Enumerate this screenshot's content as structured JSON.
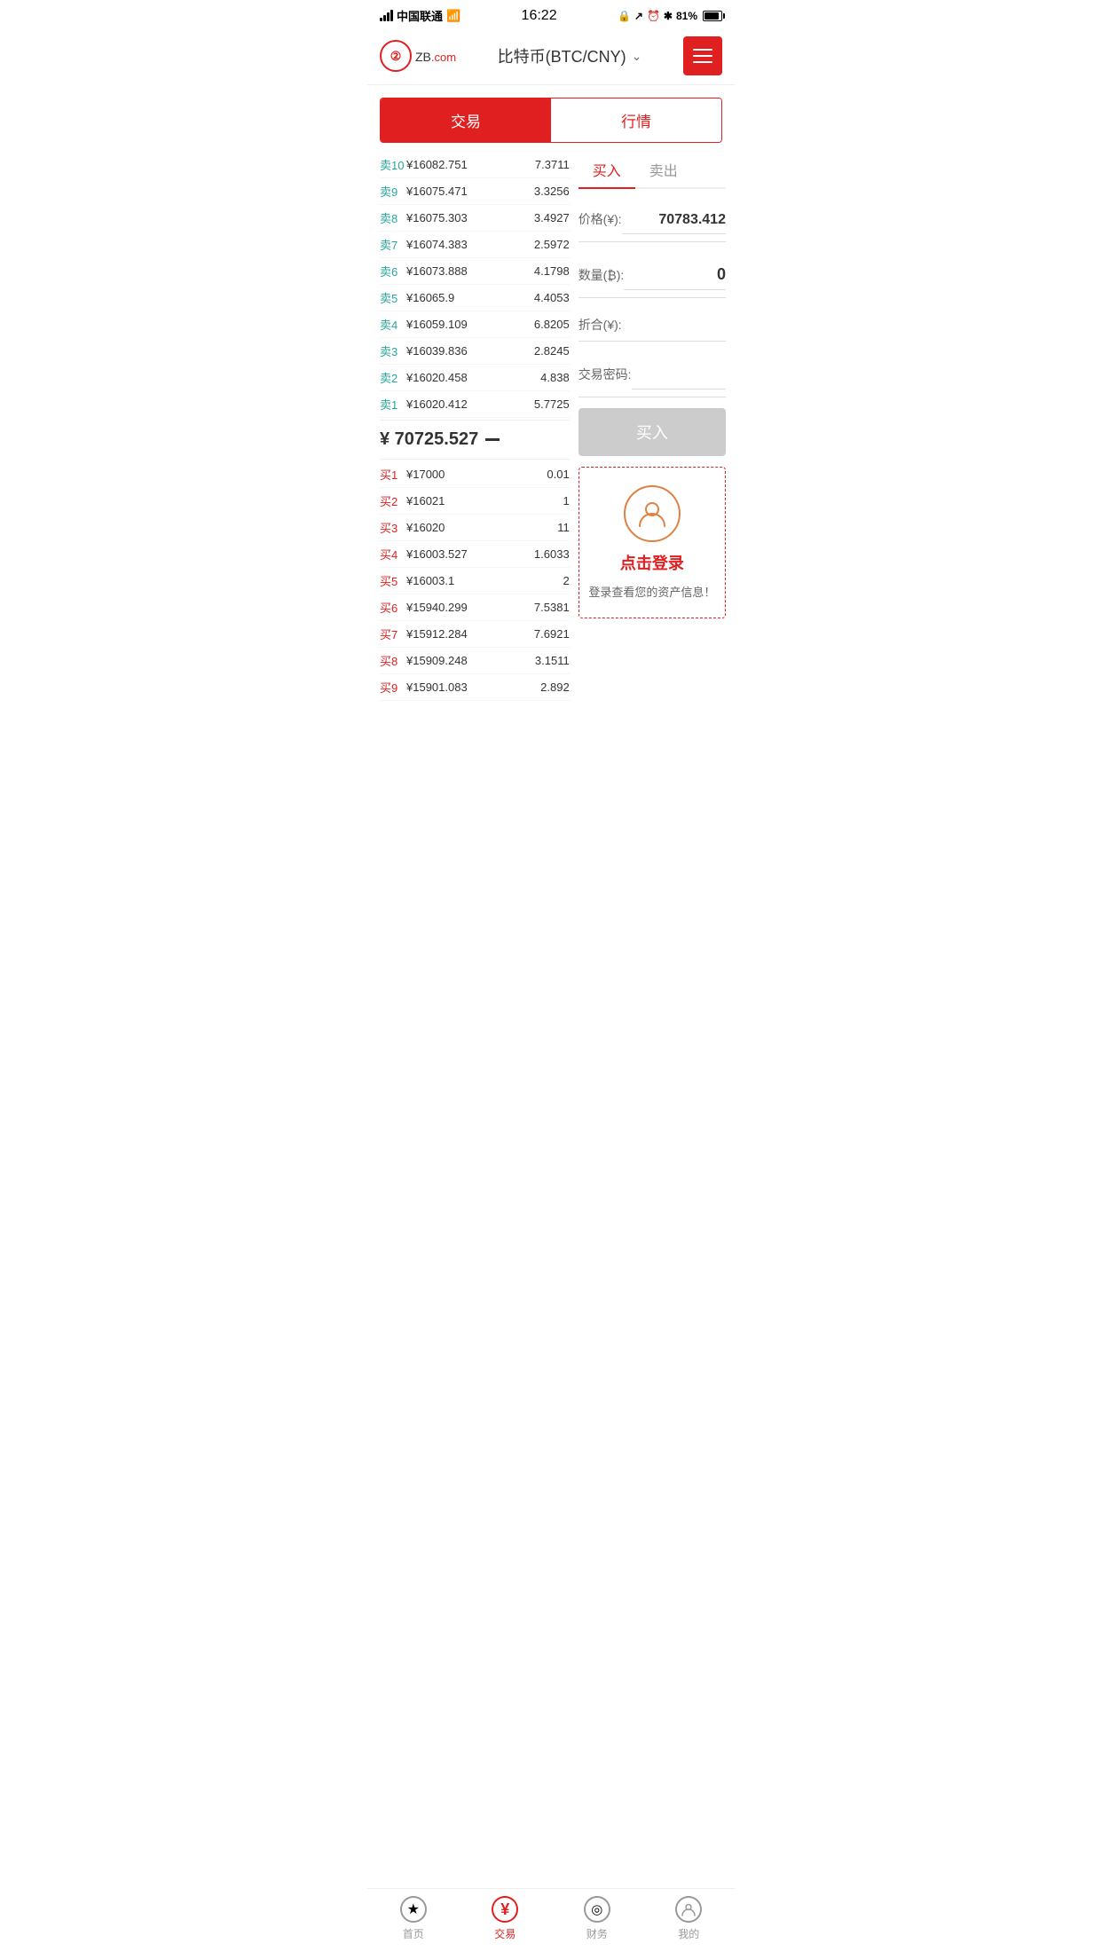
{
  "statusBar": {
    "carrier": "中国联通",
    "time": "16:22",
    "battery": "81%"
  },
  "header": {
    "logoText": "ZB",
    "logoDomain": ".com",
    "title": "比特币(BTC/CNY)",
    "menuLabel": "≡"
  },
  "tabs": {
    "left": "交易",
    "right": "行情"
  },
  "buySellTabs": {
    "buy": "买入",
    "sell": "卖出"
  },
  "sellOrders": [
    {
      "label": "卖10",
      "price": "¥16082.751",
      "qty": "7.3711"
    },
    {
      "label": "卖9",
      "price": "¥16075.471",
      "qty": "3.3256"
    },
    {
      "label": "卖8",
      "price": "¥16075.303",
      "qty": "3.4927"
    },
    {
      "label": "卖7",
      "price": "¥16074.383",
      "qty": "2.5972"
    },
    {
      "label": "卖6",
      "price": "¥16073.888",
      "qty": "4.1798"
    },
    {
      "label": "卖5",
      "price": "¥16065.9",
      "qty": "4.4053"
    },
    {
      "label": "卖4",
      "price": "¥16059.109",
      "qty": "6.8205"
    },
    {
      "label": "卖3",
      "price": "¥16039.836",
      "qty": "2.8245"
    },
    {
      "label": "卖2",
      "price": "¥16020.458",
      "qty": "4.838"
    },
    {
      "label": "卖1",
      "price": "¥16020.412",
      "qty": "5.7725"
    }
  ],
  "currentPrice": "¥ 70725.527",
  "buyOrders": [
    {
      "label": "买1",
      "price": "¥17000",
      "qty": "0.01"
    },
    {
      "label": "买2",
      "price": "¥16021",
      "qty": "1"
    },
    {
      "label": "买3",
      "price": "¥16020",
      "qty": "11"
    },
    {
      "label": "买4",
      "price": "¥16003.527",
      "qty": "1.6033"
    },
    {
      "label": "买5",
      "price": "¥16003.1",
      "qty": "2"
    },
    {
      "label": "买6",
      "price": "¥15940.299",
      "qty": "7.5381"
    },
    {
      "label": "买7",
      "price": "¥15912.284",
      "qty": "7.6921"
    },
    {
      "label": "买8",
      "price": "¥15909.248",
      "qty": "3.1511"
    },
    {
      "label": "买9",
      "price": "¥15901.083",
      "qty": "2.892"
    }
  ],
  "tradeForm": {
    "priceLabel": "价格(¥):",
    "priceValue": "70783.412",
    "qtyLabel": "数量(₿):",
    "qtyValue": "0",
    "totalLabel": "折合(¥):",
    "totalValue": "",
    "passwordLabel": "交易密码:",
    "passwordValue": "",
    "buyBtnLabel": "买入"
  },
  "loginPrompt": {
    "text": "点击登录",
    "subtext": "登录查看您的资产信息！"
  },
  "bottomNav": [
    {
      "key": "home",
      "label": "首页",
      "icon": "★",
      "active": false
    },
    {
      "key": "trade",
      "label": "交易",
      "icon": "¥",
      "active": true
    },
    {
      "key": "finance",
      "label": "财务",
      "icon": "💰",
      "active": false
    },
    {
      "key": "profile",
      "label": "我的",
      "icon": "👤",
      "active": false
    }
  ]
}
